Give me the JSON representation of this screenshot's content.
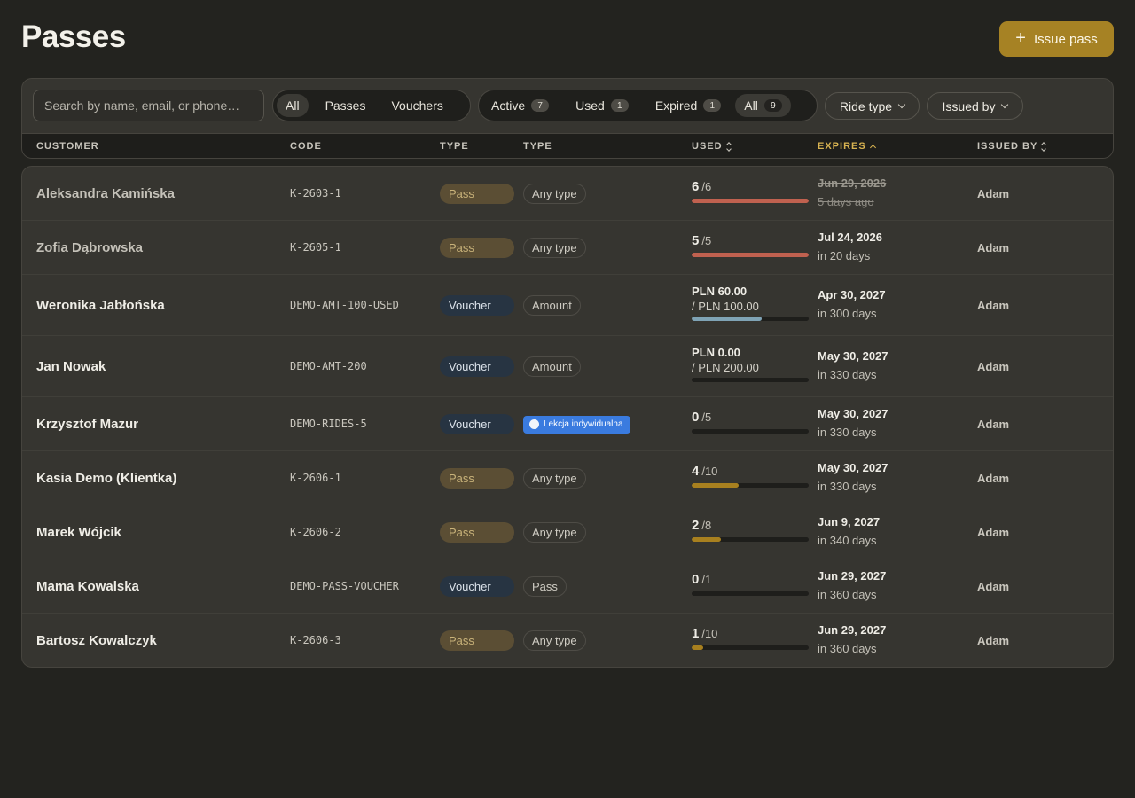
{
  "header": {
    "title": "Passes",
    "issue_label": "Issue pass"
  },
  "filters": {
    "search_placeholder": "Search by name, email, or phone…",
    "kind_tabs": [
      {
        "label": "All",
        "active": true
      },
      {
        "label": "Passes",
        "active": false
      },
      {
        "label": "Vouchers",
        "active": false
      }
    ],
    "status_tabs": [
      {
        "label": "Active",
        "count": "7",
        "active": false
      },
      {
        "label": "Used",
        "count": "1",
        "active": false
      },
      {
        "label": "Expired",
        "count": "1",
        "active": false
      },
      {
        "label": "All",
        "count": "9",
        "active": true
      }
    ],
    "ride_type_label": "Ride type",
    "issued_by_label": "Issued by"
  },
  "columns": {
    "customer": "CUSTOMER",
    "code": "CODE",
    "type": "TYPE",
    "type2": "TYPE",
    "used": "USED",
    "expires": "EXPIRES",
    "issued_by": "ISSUED BY"
  },
  "colors": {
    "accent": "#a68224",
    "bar_red": "#c0614f",
    "bar_gold": "#a8801f",
    "bar_blue": "#7fa3b5",
    "ride_tag": "#3a7bdf"
  },
  "rows": [
    {
      "customer": "Aleksandra Kamińska",
      "code": "K-2603-1",
      "kind": "Pass",
      "type": "Any type",
      "used": "6",
      "used_total": "/6",
      "progress": 1.0,
      "bar": "red",
      "expires": "Jun 29, 2026",
      "relative": "5 days ago",
      "expired": true,
      "issued_by": "Adam"
    },
    {
      "customer": "Zofia Dąbrowska",
      "code": "K-2605-1",
      "kind": "Pass",
      "type": "Any type",
      "used": "5",
      "used_total": "/5",
      "progress": 1.0,
      "bar": "red",
      "expires": "Jul 24, 2026",
      "relative": "in 20 days",
      "expired": false,
      "issued_by": "Adam"
    },
    {
      "customer": "Weronika Jabłońska",
      "code": "DEMO-AMT-100-USED",
      "kind": "Voucher",
      "type": "Amount",
      "amount": "PLN 60.00",
      "amount_total": "/ PLN 100.00",
      "progress": 0.6,
      "bar": "blue",
      "expires": "Apr 30, 2027",
      "relative": "in 300 days",
      "expired": false,
      "issued_by": "Adam"
    },
    {
      "customer": "Jan Nowak",
      "code": "DEMO-AMT-200",
      "kind": "Voucher",
      "type": "Amount",
      "amount": "PLN 0.00",
      "amount_total": "/ PLN 200.00",
      "progress": 0.0,
      "bar": "blue",
      "expires": "May 30, 2027",
      "relative": "in 330 days",
      "expired": false,
      "issued_by": "Adam"
    },
    {
      "customer": "Krzysztof Mazur",
      "code": "DEMO-RIDES-5",
      "kind": "Voucher",
      "ride_tag": "Lekcja indywidualna",
      "used": "0",
      "used_total": "/5",
      "progress": 0.0,
      "bar": "gold",
      "expires": "May 30, 2027",
      "relative": "in 330 days",
      "expired": false,
      "issued_by": "Adam"
    },
    {
      "customer": "Kasia Demo (Klientka)",
      "code": "K-2606-1",
      "kind": "Pass",
      "type": "Any type",
      "used": "4",
      "used_total": "/10",
      "progress": 0.4,
      "bar": "gold",
      "expires": "May 30, 2027",
      "relative": "in 330 days",
      "expired": false,
      "issued_by": "Adam"
    },
    {
      "customer": "Marek Wójcik",
      "code": "K-2606-2",
      "kind": "Pass",
      "type": "Any type",
      "used": "2",
      "used_total": "/8",
      "progress": 0.25,
      "bar": "gold",
      "expires": "Jun 9, 2027",
      "relative": "in 340 days",
      "expired": false,
      "issued_by": "Adam"
    },
    {
      "customer": "Mama Kowalska",
      "code": "DEMO-PASS-VOUCHER",
      "kind": "Voucher",
      "type": "Pass",
      "used": "0",
      "used_total": "/1",
      "progress": 0.0,
      "bar": "gold",
      "expires": "Jun 29, 2027",
      "relative": "in 360 days",
      "expired": false,
      "issued_by": "Adam"
    },
    {
      "customer": "Bartosz Kowalczyk",
      "code": "K-2606-3",
      "kind": "Pass",
      "type": "Any type",
      "used": "1",
      "used_total": "/10",
      "progress": 0.1,
      "bar": "gold",
      "expires": "Jun 29, 2027",
      "relative": "in 360 days",
      "expired": false,
      "issued_by": "Adam"
    }
  ]
}
